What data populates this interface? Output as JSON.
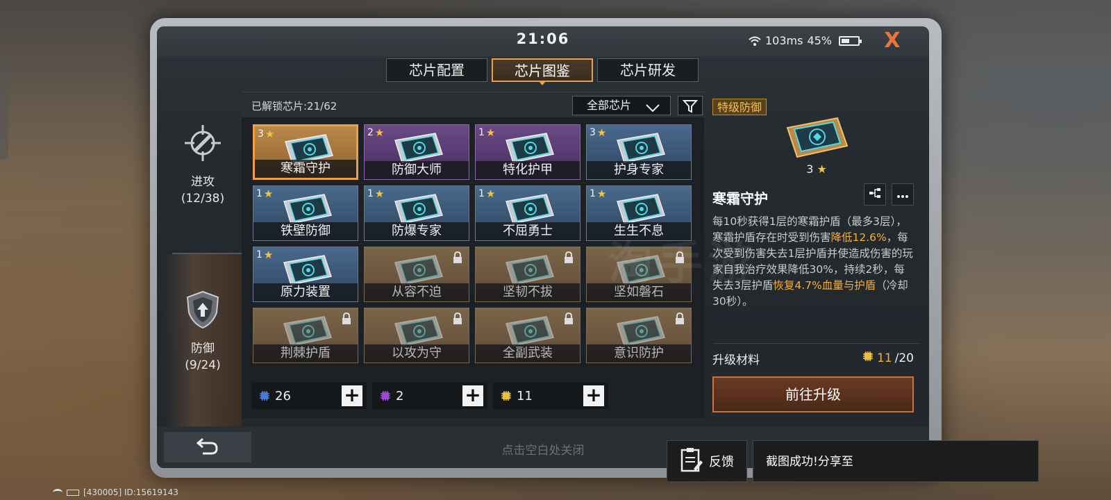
{
  "system": {
    "clock": "21:06",
    "ping": "103ms",
    "battery_percent": "45%",
    "battery_level": 0.45,
    "close_symbol": "X"
  },
  "tabs": [
    {
      "label": "芯片配置",
      "active": false
    },
    {
      "label": "芯片图鉴",
      "active": true
    },
    {
      "label": "芯片研发",
      "active": false
    }
  ],
  "categories": {
    "attack": {
      "label": "进攻",
      "count": "(12/38)",
      "icon": "crosshair-icon"
    },
    "defense": {
      "label": "防御",
      "count": "(9/24)",
      "icon": "shield-icon"
    }
  },
  "chip_panel": {
    "unlocked_text": "已解锁芯片:21/62",
    "filter_label": "全部芯片",
    "chips": [
      {
        "name": "寒霜守护",
        "stars": "3",
        "rarity": "gold",
        "locked": false,
        "selected": true
      },
      {
        "name": "防御大师",
        "stars": "2",
        "rarity": "purple",
        "locked": false,
        "selected": false
      },
      {
        "name": "特化护甲",
        "stars": "1",
        "rarity": "purple",
        "locked": false,
        "selected": false
      },
      {
        "name": "护身专家",
        "stars": "3",
        "rarity": "blue",
        "locked": false,
        "selected": false
      },
      {
        "name": "铁壁防御",
        "stars": "1",
        "rarity": "blue",
        "locked": false,
        "selected": false
      },
      {
        "name": "防爆专家",
        "stars": "1",
        "rarity": "blue",
        "locked": false,
        "selected": false
      },
      {
        "name": "不屈勇士",
        "stars": "1",
        "rarity": "blue",
        "locked": false,
        "selected": false
      },
      {
        "name": "生生不息",
        "stars": "1",
        "rarity": "blue",
        "locked": false,
        "selected": false
      },
      {
        "name": "原力装置",
        "stars": "1",
        "rarity": "blue",
        "locked": false,
        "selected": false
      },
      {
        "name": "从容不迫",
        "stars": "",
        "rarity": "locked",
        "locked": true,
        "selected": false
      },
      {
        "name": "坚韧不拔",
        "stars": "",
        "rarity": "locked",
        "locked": true,
        "selected": false
      },
      {
        "name": "坚如磐石",
        "stars": "",
        "rarity": "locked",
        "locked": true,
        "selected": false
      },
      {
        "name": "荆棘护盾",
        "stars": "",
        "rarity": "locked",
        "locked": true,
        "selected": false
      },
      {
        "name": "以攻为守",
        "stars": "",
        "rarity": "locked",
        "locked": true,
        "selected": false
      },
      {
        "name": "全副武装",
        "stars": "",
        "rarity": "locked",
        "locked": true,
        "selected": false
      },
      {
        "name": "意识防护",
        "stars": "",
        "rarity": "locked",
        "locked": true,
        "selected": false
      }
    ],
    "resources": [
      {
        "value": "26",
        "color": "#4a7ad8",
        "icon": "blue-chip-icon"
      },
      {
        "value": "2",
        "color": "#9a4ad0",
        "icon": "purple-chip-icon"
      },
      {
        "value": "11",
        "color": "#e8c040",
        "icon": "gold-chip-icon"
      }
    ]
  },
  "detail": {
    "rarity_badge": "特级防御",
    "stars": "3",
    "name": "寒霜守护",
    "desc_1": "每10秒获得1层的寒霜护盾（最多3层），寒霜护盾存在时受到伤害",
    "desc_hl_1": "降低12.6%",
    "desc_2": "，每次受到伤害失去1层护盾并使造成伤害的玩家自我治疗效果降低30%，持续2秒，每失去3层护盾",
    "desc_hl_2": "恢复4.7%血量与护盾",
    "desc_3": "（冷却30秒）。",
    "upgrade_label": "升级材料",
    "upgrade_have": "11",
    "upgrade_need": "/20",
    "upgrade_button": "前往升级"
  },
  "bottom": {
    "tap_close": "点击空白处关闭"
  },
  "overlay": {
    "feedback_label": "反馈",
    "share_text": "截图成功!分享至"
  },
  "device_status": {
    "id_text": "[430005] ID:15619143"
  },
  "watermark": "淘手游"
}
